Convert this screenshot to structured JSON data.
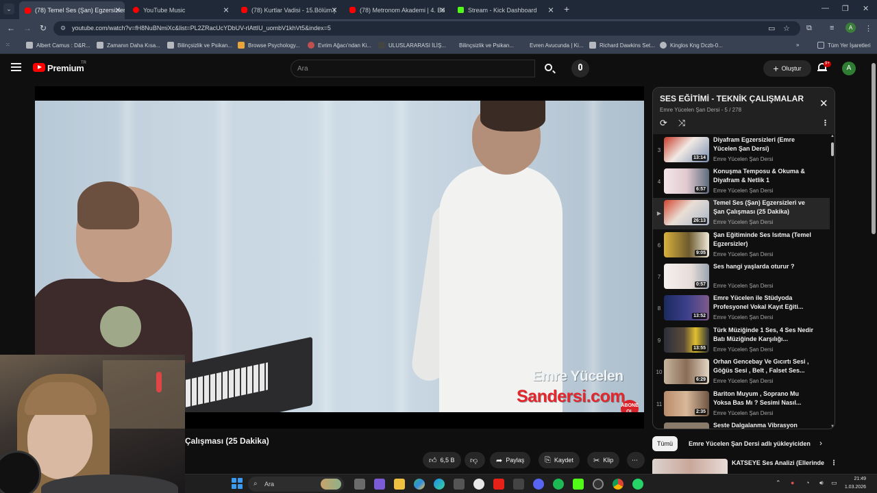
{
  "browser": {
    "tabs": [
      {
        "label": "(78) Temel Ses (Şan) Egzersizleri",
        "favicon": "youtube",
        "active": true
      },
      {
        "label": "YouTube Music",
        "favicon": "youtube-music",
        "active": false
      },
      {
        "label": "(78) Kurtlar Vadisi - 15.Bölüm |",
        "favicon": "youtube",
        "active": false
      },
      {
        "label": "(78) Metronom Akademi | 4. Bö",
        "favicon": "youtube",
        "active": false
      },
      {
        "label": "Stream - Kick Dashboard",
        "favicon": "kick",
        "active": false
      }
    ],
    "url": "youtube.com/watch?v=fH8NuBNmiXc&list=PL2ZRacUcYDbUV-rlAttIU_uombV1khVt5&index=5",
    "profile_initial": "A",
    "bookmarks": [
      "Albert Camus : D&R...",
      "Zamanın Daha Kısa...",
      "Bilinçsizlik ve Psikan...",
      "Browse Psychology...",
      "Evrim Ağacı'ndan Ki...",
      "ULUSLARARASI İLİŞ...",
      "Bilinçsizlik ve Psikan...",
      "Evren Avucunda | Ki...",
      "Richard Dawkins Set...",
      "Kinglos Kng Dczb-0..."
    ],
    "all_bookmarks_label": "Tüm Yer İşaretleri"
  },
  "youtube": {
    "brand": "Premium",
    "country": "TR",
    "search_placeholder": "Ara",
    "create_label": "Oluştur",
    "notification_count": "9+",
    "avatar_initial": "A"
  },
  "video": {
    "title": "Çalışması (25 Dakika)",
    "watermark_line1": "Emre Yücelen",
    "watermark_line2": "Sandersi.com",
    "abone_label": "ABONE OL",
    "actions": {
      "likes": "6,5 B",
      "share": "Paylaş",
      "save": "Kaydet",
      "clip": "Klip",
      "more": "⋯"
    }
  },
  "playlist": {
    "title": "SES EĞİTİMİ - TEKNİK ÇALIŞMALAR",
    "subtitle": "Emre Yücelen Şan Dersi - 5 / 278",
    "items": [
      {
        "index": "3",
        "title": "Diyafram Egzersizleri (Emre Yücelen Şan Dersi)",
        "channel": "Emre Yücelen Şan Dersi",
        "duration": "13:14",
        "active": false
      },
      {
        "index": "4",
        "title": "Konuşma Temposu & Okuma & Diyafram & Netlik 1",
        "channel": "Emre Yücelen Şan Dersi",
        "duration": "6:57",
        "active": false
      },
      {
        "index": "▶",
        "title": "Temel Ses (Şan) Egzersizleri ve Şan Çalışması (25 Dakika)",
        "channel": "Emre Yücelen Şan Dersi",
        "duration": "26:13",
        "active": true
      },
      {
        "index": "6",
        "title": "Şan Eğitiminde Ses Isıtma (Temel Egzersizler)",
        "channel": "Emre Yücelen Şan Dersi",
        "duration": "9:05",
        "active": false
      },
      {
        "index": "7",
        "title": "Ses hangi yaşlarda oturur ?",
        "channel": "Emre Yücelen Şan Dersi",
        "duration": "0:57",
        "active": false
      },
      {
        "index": "8",
        "title": "Emre Yücelen ile Stüdyoda Profesyonel Vokal Kayıt Eğiti...",
        "channel": "Emre Yücelen Şan Dersi",
        "duration": "13:52",
        "active": false
      },
      {
        "index": "9",
        "title": "Türk Müziğinde 1 Ses, 4 Ses Nedir Batı Müziğinde Karşılığı...",
        "channel": "Emre Yücelen Şan Dersi",
        "duration": "13:55",
        "active": false
      },
      {
        "index": "10",
        "title": "Orhan Gencebay Ve Gıcırtı Sesi , Göğüs Sesi , Belt , Falset Ses...",
        "channel": "Emre Yücelen Şan Dersi",
        "duration": "6:29",
        "active": false
      },
      {
        "index": "11",
        "title": "Bariton Muyum , Soprano Mu Yoksa Bas Mı ? Sesimi Nasıl...",
        "channel": "Emre Yücelen Şan Dersi",
        "duration": "2:35",
        "active": false
      },
      {
        "index": "12",
        "title": "Seste Dalgalanma Vibrasyon",
        "channel": "",
        "duration": "",
        "active": false
      }
    ]
  },
  "chips": {
    "all": "Tümü",
    "uploader": "Emre Yücelen Şan Dersi adlı yükleyiciden"
  },
  "recommendation": {
    "title": "KATSEYE Ses Analizi (Ellerinde"
  },
  "taskbar": {
    "search_placeholder": "Ara",
    "time": "21:49",
    "date": "1.03.2026"
  },
  "colors": {
    "youtube_red": "#ff0000",
    "kick_green": "#53fc18",
    "avatar_green": "#2e7d32",
    "watermark_red": "#e3272d"
  }
}
